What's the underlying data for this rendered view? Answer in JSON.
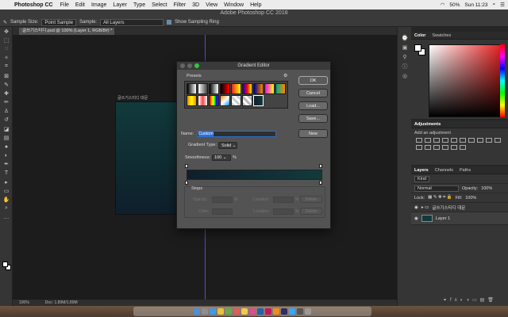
{
  "menubar": {
    "app": "Photoshop CC",
    "items": [
      "File",
      "Edit",
      "Image",
      "Layer",
      "Type",
      "Select",
      "Filter",
      "3D",
      "View",
      "Window",
      "Help"
    ],
    "battery": "50%",
    "datetime": "Sun 11:23"
  },
  "window_title": "Adobe Photoshop CC 2018",
  "options": {
    "sample_size_label": "Sample Size:",
    "sample_size": "Point Sample",
    "sample_label": "Sample:",
    "sample": "All Layers",
    "show_ring": "Show Sampling Ring"
  },
  "doc_tab": "글쓰기스티디.psd @ 100% (Layer 1, RGB/8#) *",
  "doc_label": "글쓰기스티디 대문",
  "status": {
    "zoom": "100%",
    "doc": "Doc: 1.89M/1.89M"
  },
  "color_panel": {
    "tabs": [
      "Color",
      "Swatches"
    ]
  },
  "adjustments": {
    "title": "Adjustments",
    "hint": "Add an adjustment"
  },
  "layers_panel": {
    "tabs": [
      "Layers",
      "Channels",
      "Paths"
    ],
    "kind": "Kind",
    "blend": "Normal",
    "opacity_label": "Opacity:",
    "opacity": "100%",
    "lock_label": "Lock:",
    "fill_label": "Fill:",
    "fill": "100%",
    "group": "글쓰기스티디 대문",
    "layer": "Layer 1"
  },
  "dialog": {
    "title": "Gradient Editor",
    "presets_label": "Presets",
    "buttons": {
      "ok": "OK",
      "cancel": "Cancel",
      "load": "Load...",
      "save": "Save...",
      "new": "New"
    },
    "name_label": "Name:",
    "name": "Custom",
    "type_label": "Gradient Type:",
    "type": "Solid",
    "smooth_label": "Smoothness:",
    "smooth": "100",
    "pct": "%",
    "stops_label": "Stops",
    "opacity_label": "Opacity:",
    "location_label": "Location:",
    "color_label": "Color:",
    "delete_label": "Delete"
  },
  "colors": {
    "gradient_start": "#0f1f2b",
    "gradient_end": "#123a3b"
  }
}
